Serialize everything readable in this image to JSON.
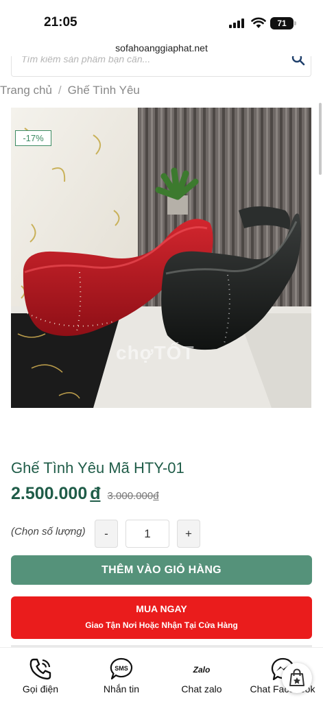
{
  "status_bar": {
    "time": "21:05",
    "battery": "71",
    "icons": [
      "signal-icon",
      "wifi-icon",
      "battery-icon"
    ]
  },
  "browser": {
    "url": "sofahoanggiaphat.net"
  },
  "search": {
    "placeholder": "Tìm kiếm sản phẩm bạn cần..."
  },
  "breadcrumb": {
    "home": "Trang chủ",
    "separator": "/",
    "current": "Ghế Tình Yêu"
  },
  "product": {
    "discount_badge": "-17%",
    "watermark": "chợTỐT",
    "title": "Ghế Tình Yêu Mã HTY-01",
    "price_current": "2.500.000",
    "price_current_currency": "đ",
    "price_old": "3.000.000",
    "price_old_currency": "đ"
  },
  "quantity": {
    "label": "(Chọn số lượng)",
    "minus": "-",
    "value": "1",
    "plus": "+"
  },
  "actions": {
    "add_to_cart": "THÊM VÀO GIỎ HÀNG",
    "buy_now_title": "MUA NGAY",
    "buy_now_subtitle": "Giao Tận Nơi Hoặc Nhận Tại Cửa Hàng"
  },
  "bottom_bar": {
    "items": [
      {
        "label": "Gọi điện",
        "icon": "phone-icon"
      },
      {
        "label": "Nhắn tin",
        "icon": "sms-icon"
      },
      {
        "label": "Chat zalo",
        "icon": "zalo-icon"
      },
      {
        "label": "Chat Facebook",
        "icon": "messenger-icon"
      }
    ]
  },
  "colors": {
    "brand_green": "#1f5c48",
    "button_green": "#55927a",
    "buy_red": "#ea1c1c",
    "badge_green": "#3c8a62"
  }
}
